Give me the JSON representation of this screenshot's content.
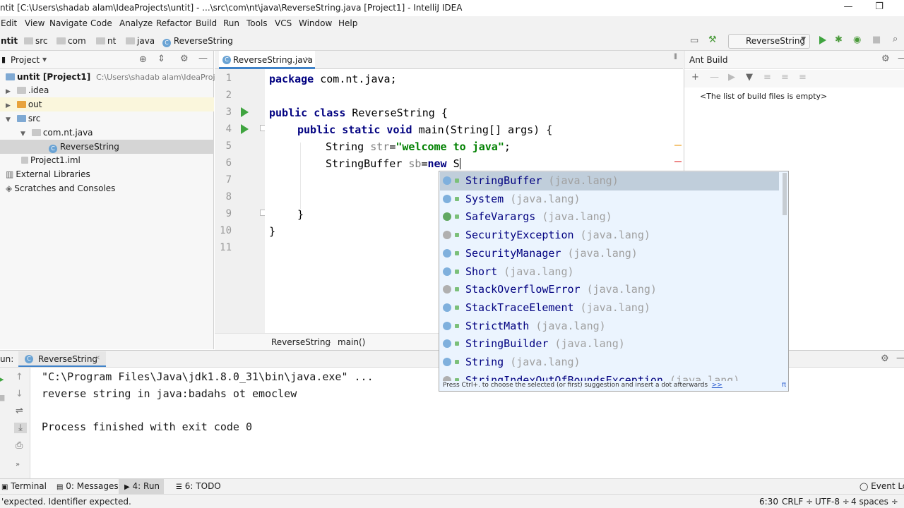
{
  "window": {
    "title": "ntit [C:\\Users\\shadab alam\\IdeaProjects\\untit] - ...\\src\\com\\nt\\java\\ReverseString.java [Project1] - IntelliJ IDEA",
    "minimize_glyph": "—",
    "restore_glyph": "❐"
  },
  "menu": [
    "Edit",
    "View",
    "Navigate",
    "Code",
    "Analyze",
    "Refactor",
    "Build",
    "Run",
    "Tools",
    "VCS",
    "Window",
    "Help"
  ],
  "breadcrumbs": [
    "ntit",
    "src",
    "com",
    "nt",
    "java",
    "ReverseString"
  ],
  "toolbar": {
    "run_config": "ReverseString"
  },
  "project_panel": {
    "title": "Project",
    "tree": [
      {
        "label": "untit [Project1]",
        "hint": "C:\\Users\\shadab alam\\IdeaProjects\\u"
      },
      {
        "label": ".idea"
      },
      {
        "label": "out"
      },
      {
        "label": "src"
      },
      {
        "label": "com.nt.java"
      },
      {
        "label": "ReverseString"
      },
      {
        "label": "Project1.iml"
      },
      {
        "label": "External Libraries"
      },
      {
        "label": "Scratches and Consoles"
      }
    ]
  },
  "editor": {
    "tab": "ReverseString.java",
    "line_numbers": [
      "1",
      "2",
      "3",
      "4",
      "5",
      "6",
      "7",
      "8",
      "9",
      "10",
      "11"
    ],
    "code": {
      "l1_kw": "package",
      "l1_rest": " com.nt.java;",
      "l3_kw": "public class",
      "l3_rest": " ReverseString {",
      "l4_kw": "public static void",
      "l4_rest": " main(String[] args) {",
      "l5_a": "String ",
      "l5_var": "str",
      "l5_eq": "=",
      "l5_str": "\"welcome to java\"",
      "l5_end": ";",
      "l6_a": "StringBuffer ",
      "l6_var": "sb",
      "l6_eq": "=",
      "l6_kw": "new",
      "l6_end": " S",
      "l9": "}",
      "l10": "}"
    },
    "breadcrumb": {
      "cls": "ReverseString",
      "method": "main()"
    }
  },
  "completion": {
    "items": [
      {
        "name": "StringBuffer",
        "pkg": " (java.lang)",
        "kind": "class"
      },
      {
        "name": "System",
        "pkg": " (java.lang)",
        "kind": "class"
      },
      {
        "name": "SafeVarargs",
        "pkg": " (java.lang)",
        "kind": "annotation"
      },
      {
        "name": "SecurityException",
        "pkg": " (java.lang)",
        "kind": "exception"
      },
      {
        "name": "SecurityManager",
        "pkg": " (java.lang)",
        "kind": "class"
      },
      {
        "name": "Short",
        "pkg": " (java.lang)",
        "kind": "class"
      },
      {
        "name": "StackOverflowError",
        "pkg": " (java.lang)",
        "kind": "exception"
      },
      {
        "name": "StackTraceElement",
        "pkg": " (java.lang)",
        "kind": "class"
      },
      {
        "name": "StrictMath",
        "pkg": " (java.lang)",
        "kind": "class"
      },
      {
        "name": "StringBuilder",
        "pkg": " (java.lang)",
        "kind": "class"
      },
      {
        "name": "String",
        "pkg": " (java.lang)",
        "kind": "class"
      },
      {
        "name": "StringIndexOutOfBoundsException",
        "pkg": " (java.lang)",
        "kind": "exception"
      }
    ],
    "hint": "Press Ctrl+. to choose the selected (or first) suggestion and insert a dot afterwards",
    "hint_link": ">>",
    "pi_glyph": "π"
  },
  "ant_build": {
    "title": "Ant Build",
    "empty": "<The list of build files is empty>"
  },
  "run_panel": {
    "label": "un:",
    "tab": "ReverseString",
    "output": [
      "\"C:\\Program Files\\Java\\jdk1.8.0_31\\bin\\java.exe\" ...",
      "reverse string in java:badahs ot emoclew",
      "",
      "Process finished with exit code 0"
    ]
  },
  "tool_tabs": {
    "terminal": "Terminal",
    "messages": "0: Messages",
    "run": "4: Run",
    "todo": "6: TODO",
    "event_log": "Event Log"
  },
  "status": {
    "message": "'expected. Identifier expected.",
    "position": "6:30",
    "line_sep": "CRLF ÷",
    "encoding": "UTF-8 ÷",
    "indent": "4 spaces ÷"
  },
  "colors": {
    "keyword": "#000080",
    "string": "#008000",
    "selection": "#c0cedb",
    "popup_bg": "#ebf4fe",
    "run_green": "#3fa43f"
  }
}
